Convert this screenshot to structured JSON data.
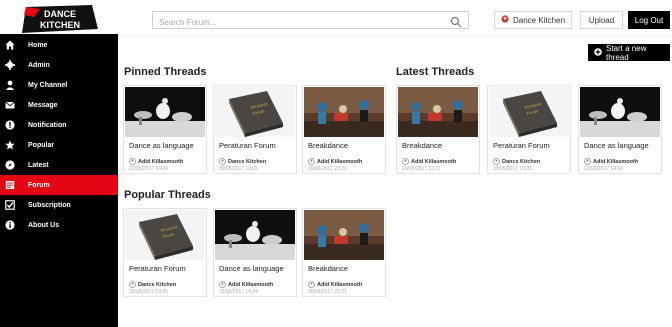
{
  "brand": {
    "logo_line1": "DANCE",
    "logo_line2": "KITCHEN"
  },
  "search": {
    "placeholder": "Search Forum..."
  },
  "header": {
    "user_label": "Dance Kitchen",
    "upload_label": "Upload",
    "logout_label": "Log Out"
  },
  "sidebar": {
    "items": [
      {
        "label": "Home",
        "icon": "home-icon"
      },
      {
        "label": "Admin",
        "icon": "gear-icon"
      },
      {
        "label": "My Channel",
        "icon": "user-icon"
      },
      {
        "label": "Message",
        "icon": "envelope-icon"
      },
      {
        "label": "Notification",
        "icon": "alert-icon"
      },
      {
        "label": "Popular",
        "icon": "star-icon"
      },
      {
        "label": "Latest",
        "icon": "compass-icon"
      },
      {
        "label": "Forum",
        "icon": "forum-icon",
        "active": true
      },
      {
        "label": "Subscription",
        "icon": "checkbox-icon"
      },
      {
        "label": "About Us",
        "icon": "info-icon"
      }
    ]
  },
  "actions": {
    "new_thread_label": "Start a new thread"
  },
  "sections": {
    "pinned": {
      "title": "Pinned Threads",
      "threads": [
        {
          "title": "Dance as language",
          "author": "Adid Killasmooth",
          "date": "22/05/2017 14:24"
        },
        {
          "title": "Peraturan Forum",
          "author": "Dance Kitchen",
          "date": "30/05/2017 19:05"
        },
        {
          "title": "Breakdance",
          "author": "Adid Killasmooth",
          "date": "20/06/2017 23:21"
        }
      ]
    },
    "latest": {
      "title": "Latest Threads",
      "threads": [
        {
          "title": "Breakdance",
          "author": "Adid Killasmooth",
          "date": "20/06/2017 23:21"
        },
        {
          "title": "Peraturan Forum",
          "author": "Dance Kitchen",
          "date": "30/05/2017 19:05"
        },
        {
          "title": "Dance as language",
          "author": "Adid Killasmooth",
          "date": "22/05/2017 14:24"
        }
      ]
    },
    "popular": {
      "title": "Popular Threads",
      "threads": [
        {
          "title": "Peraturan Forum",
          "author": "Dance Kitchen",
          "date": "30/05/2017 19:05"
        },
        {
          "title": "Dance as language",
          "author": "Adid Killasmooth",
          "date": "22/05/2017 14:24"
        },
        {
          "title": "Breakdance",
          "author": "Adid Killasmooth",
          "date": "20/06/2017 23:21"
        }
      ]
    }
  },
  "colors": {
    "accent": "#e30613",
    "sidebar_bg": "#000000"
  }
}
